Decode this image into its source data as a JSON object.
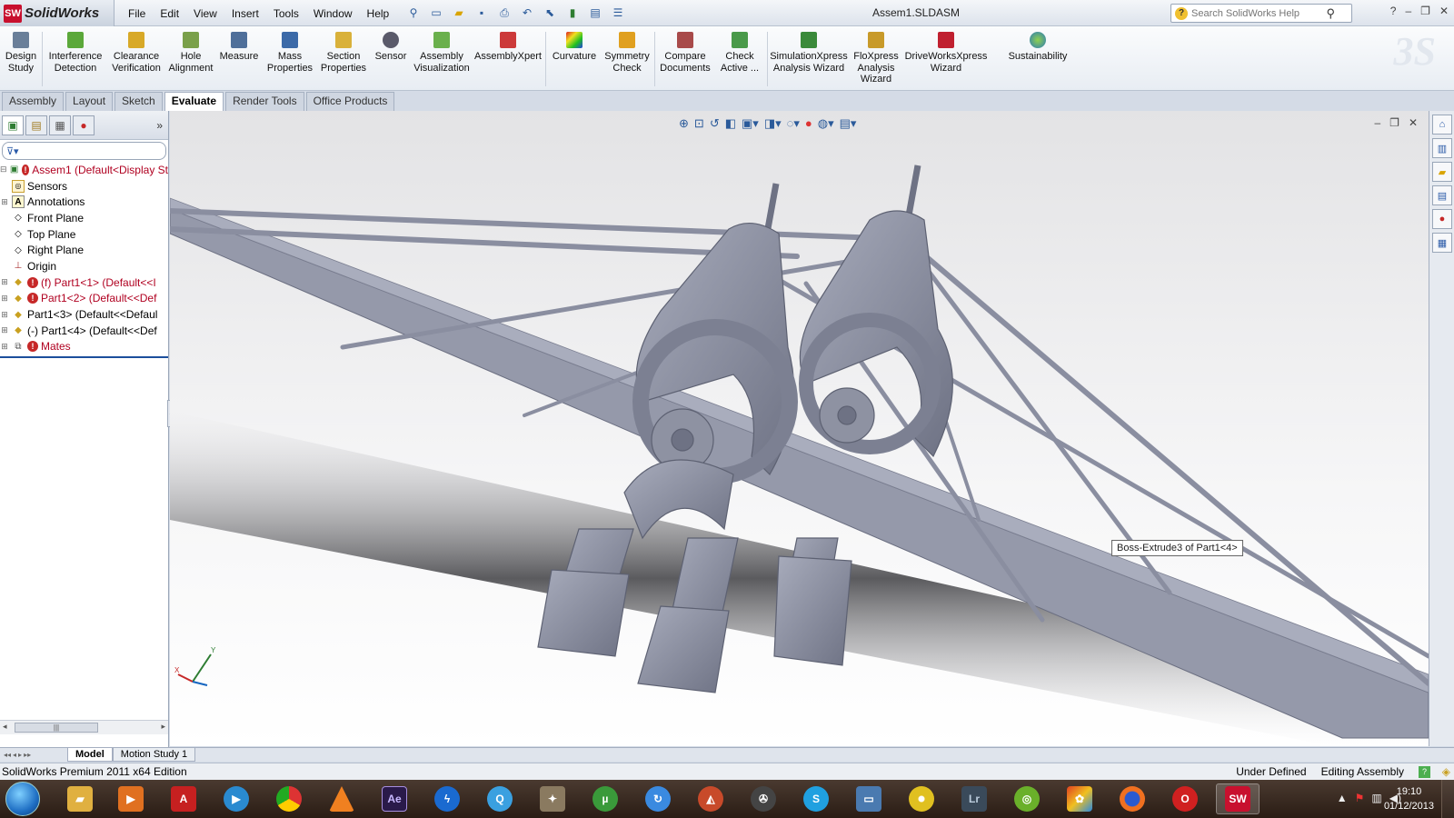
{
  "app": {
    "name": "SolidWorks",
    "badge": "SW",
    "document_title": "Assem1.SLDASM"
  },
  "menu": [
    "File",
    "Edit",
    "View",
    "Insert",
    "Tools",
    "Window",
    "Help"
  ],
  "search": {
    "placeholder": "Search SolidWorks Help"
  },
  "ribbon": {
    "design_study": "Design Study",
    "interference": "Interference Detection",
    "clearance": "Clearance Verification",
    "hole_alignment": "Hole Alignment",
    "measure": "Measure",
    "mass_properties": "Mass Properties",
    "section_properties": "Section Properties",
    "sensor": "Sensor",
    "assembly_visualization": "Assembly Visualization",
    "assemblyxpert": "AssemblyXpert",
    "curvature": "Curvature",
    "symmetry_check": "Symmetry Check",
    "compare_documents": "Compare Documents",
    "check_active": "Check Active ...",
    "simulationxpress": "SimulationXpress Analysis Wizard",
    "floxpress": "FloXpress Analysis Wizard",
    "driveworksxpress": "DriveWorksXpress Wizard",
    "sustainability": "Sustainability"
  },
  "tabs": [
    "Assembly",
    "Layout",
    "Sketch",
    "Evaluate",
    "Render Tools",
    "Office Products"
  ],
  "active_tab": "Evaluate",
  "tree": {
    "root": "Assem1  (Default<Display St",
    "sensors": "Sensors",
    "annotations": "Annotations",
    "front_plane": "Front Plane",
    "top_plane": "Top Plane",
    "right_plane": "Right Plane",
    "origin": "Origin",
    "part1": "(f) Part1<1> (Default<<I",
    "part2": "Part1<2> (Default<<Def",
    "part3": "Part1<3> (Default<<Defaul",
    "part4": "(-) Part1<4> (Default<<Def",
    "mates": "Mates"
  },
  "tooltip": "Boss-Extrude3 of Part1<4>",
  "bottom_tabs": {
    "model": "Model",
    "motion": "Motion Study 1"
  },
  "status": {
    "edition": "SolidWorks Premium 2011 x64 Edition",
    "defined": "Under Defined",
    "editing": "Editing Assembly"
  },
  "taskbar": {
    "time": "19:10",
    "date": "01/12/2013"
  },
  "colors": {
    "model_gray": "#8a8e9e",
    "accent_red": "#c8102e",
    "tree_error_red": "#b00020"
  }
}
